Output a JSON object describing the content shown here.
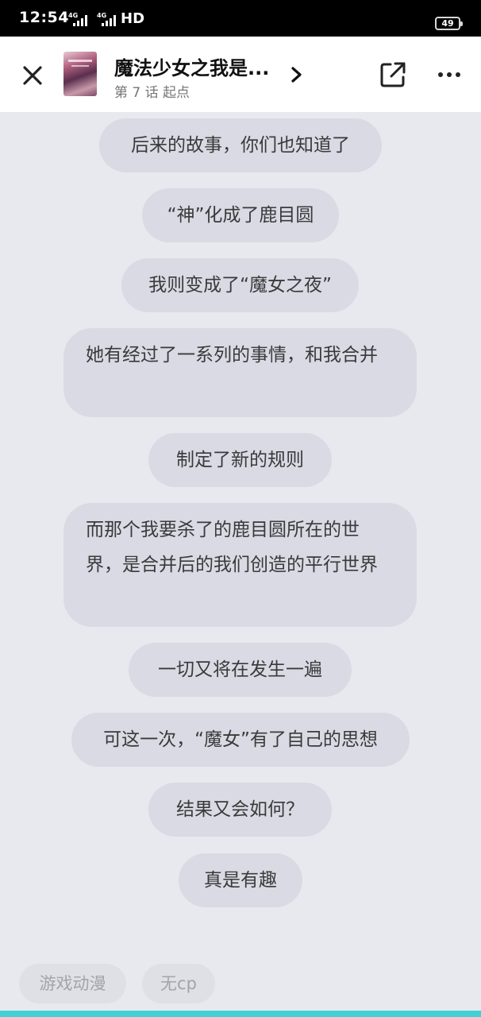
{
  "status_bar": {
    "time": "12:54",
    "network_label_1": "4G",
    "network_label_2": "4G",
    "hd_label": "HD",
    "battery": "49"
  },
  "header": {
    "title": "魔法少女之我是...",
    "subtitle": "第 7 话  起点"
  },
  "messages": [
    "后来的故事，你们也知道了",
    "“神”化成了鹿目圆",
    "我则变成了“魔女之夜”",
    "她有经过了一系列的事情，和我合并",
    "制定了新的规则",
    "而那个我要杀了的鹿目圆所在的世界，是合并后的我们创造的平行世界",
    "一切又将在发生一遍",
    "可这一次，“魔女”有了自己的思想",
    "结果又会如何？",
    "真是有趣"
  ],
  "tags": [
    "游戏动漫",
    "无cp"
  ],
  "colors": {
    "background": "#e8e9ee",
    "bubble": "#d9dae4",
    "accent_strip": "#41d1d6"
  },
  "icons": {
    "close": "close-icon",
    "next": "chevron-right-icon",
    "share": "share-icon",
    "more": "more-icon"
  }
}
